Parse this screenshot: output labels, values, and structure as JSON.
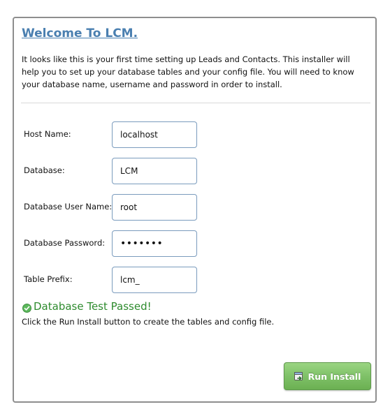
{
  "page": {
    "title": "Welcome To LCM.",
    "intro": "It looks like this is your first time setting up Leads and Contacts. This installer will help you to set up your database tables and your config file. You will need to know your database name, username and password in order to install."
  },
  "form": {
    "fields": [
      {
        "label": "Host Name:",
        "value": "localhost"
      },
      {
        "label": "Database:",
        "value": "LCM"
      },
      {
        "label": "Database User Name:",
        "value": "root"
      },
      {
        "label": "Database Password:",
        "value": "•••••••"
      },
      {
        "label": "Table Prefix:",
        "value": "lcm_"
      }
    ]
  },
  "status": {
    "message": "Database Test Passed!",
    "description": "Click the Run Install button to create the tables and config file.",
    "icon": "check-circle-icon",
    "color": "#2e8b2e"
  },
  "actions": {
    "run_install_label": "Run Install",
    "run_install_icon": "install-icon",
    "color": "#7fc168"
  },
  "theme": {
    "title_color": "#4a7fb0",
    "border_color": "#8e8e8e"
  }
}
